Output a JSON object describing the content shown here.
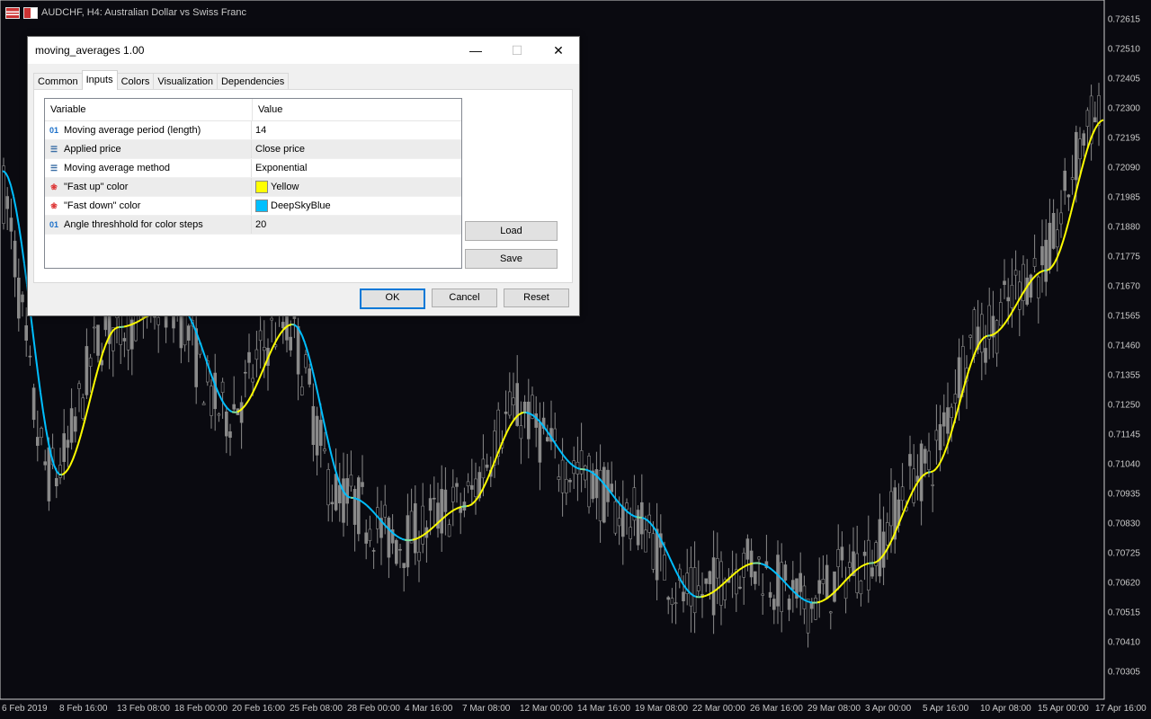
{
  "chart": {
    "symbol_title": "AUDCHF, H4:  Australian Dollar vs Swiss  Franc",
    "price_labels": [
      "0.72615",
      "0.72510",
      "0.72405",
      "0.72300",
      "0.72195",
      "0.72090",
      "0.71985",
      "0.71880",
      "0.71775",
      "0.71670",
      "0.71565",
      "0.71460",
      "0.71355",
      "0.71250",
      "0.71145",
      "0.71040",
      "0.70935",
      "0.70830",
      "0.70725",
      "0.70620",
      "0.70515",
      "0.70410",
      "0.70305"
    ],
    "date_labels": [
      "6 Feb 2019",
      "8 Feb 16:00",
      "13 Feb 08:00",
      "18 Feb 00:00",
      "20 Feb 16:00",
      "25 Feb 08:00",
      "28 Feb 00:00",
      "4 Mar 16:00",
      "7 Mar 08:00",
      "12 Mar 00:00",
      "14 Mar 16:00",
      "19 Mar 08:00",
      "22 Mar 00:00",
      "26 Mar 16:00",
      "29 Mar 08:00",
      "3 Apr 00:00",
      "5 Apr 16:00",
      "10 Apr 08:00",
      "15 Apr 00:00",
      "17 Apr 16:00"
    ],
    "colors": {
      "background": "#0a0a10",
      "candles": "#8a8a8a",
      "ma_up": "#ffff00",
      "ma_down": "#00bfff",
      "text": "#c8c8c8"
    }
  },
  "chart_data": {
    "type": "line",
    "title": "AUDCHF, H4:  Australian Dollar vs Swiss  Franc",
    "ylim": [
      0.7025,
      0.7267
    ],
    "x": [
      "6 Feb 2019",
      "8 Feb 16:00",
      "13 Feb 08:00",
      "18 Feb 00:00",
      "20 Feb 16:00",
      "25 Feb 08:00",
      "28 Feb 00:00",
      "4 Mar 16:00",
      "7 Mar 08:00",
      "12 Mar 00:00",
      "14 Mar 16:00",
      "19 Mar 08:00",
      "22 Mar 00:00",
      "26 Mar 16:00",
      "29 Mar 08:00",
      "3 Apr 00:00",
      "5 Apr 16:00",
      "10 Apr 08:00",
      "15 Apr 00:00",
      "17 Apr 16:00"
    ],
    "series": [
      {
        "values": [
          0.721,
          0.7103,
          0.7155,
          0.7163,
          0.7125,
          0.7156,
          0.7095,
          0.708,
          0.7092,
          0.7125,
          0.7105,
          0.7088,
          0.706,
          0.7072,
          0.7058,
          0.7072,
          0.7104,
          0.7152,
          0.7175,
          0.7228
        ]
      }
    ]
  },
  "dialog": {
    "title": "moving_averages 1.00",
    "controls": {
      "minimize": "—",
      "maximize": "☐",
      "close": "✕"
    },
    "tabs": [
      "Common",
      "Inputs",
      "Colors",
      "Visualization",
      "Dependencies"
    ],
    "active_tab": "Inputs",
    "table": {
      "headers": [
        "Variable",
        "Value"
      ],
      "rows": [
        {
          "icon": "numeric-icon",
          "icon_glyph": "01",
          "variable": "Moving average period (length)",
          "value": "14"
        },
        {
          "icon": "enum-icon",
          "icon_glyph": "☰",
          "variable": "Applied price",
          "value": "Close price"
        },
        {
          "icon": "enum-icon",
          "icon_glyph": "☰",
          "variable": "Moving average method",
          "value": "Exponential"
        },
        {
          "icon": "color-icon",
          "icon_glyph": "❀",
          "variable": "\"Fast up\" color",
          "value": "Yellow",
          "swatch": "#ffff00"
        },
        {
          "icon": "color-icon",
          "icon_glyph": "❀",
          "variable": "\"Fast down\" color",
          "value": "DeepSkyBlue",
          "swatch": "#00bfff"
        },
        {
          "icon": "numeric-icon",
          "icon_glyph": "01",
          "variable": "Angle threshhold for color steps",
          "value": "20"
        }
      ]
    },
    "buttons": {
      "load": "Load",
      "save": "Save",
      "ok": "OK",
      "cancel": "Cancel",
      "reset": "Reset"
    }
  }
}
